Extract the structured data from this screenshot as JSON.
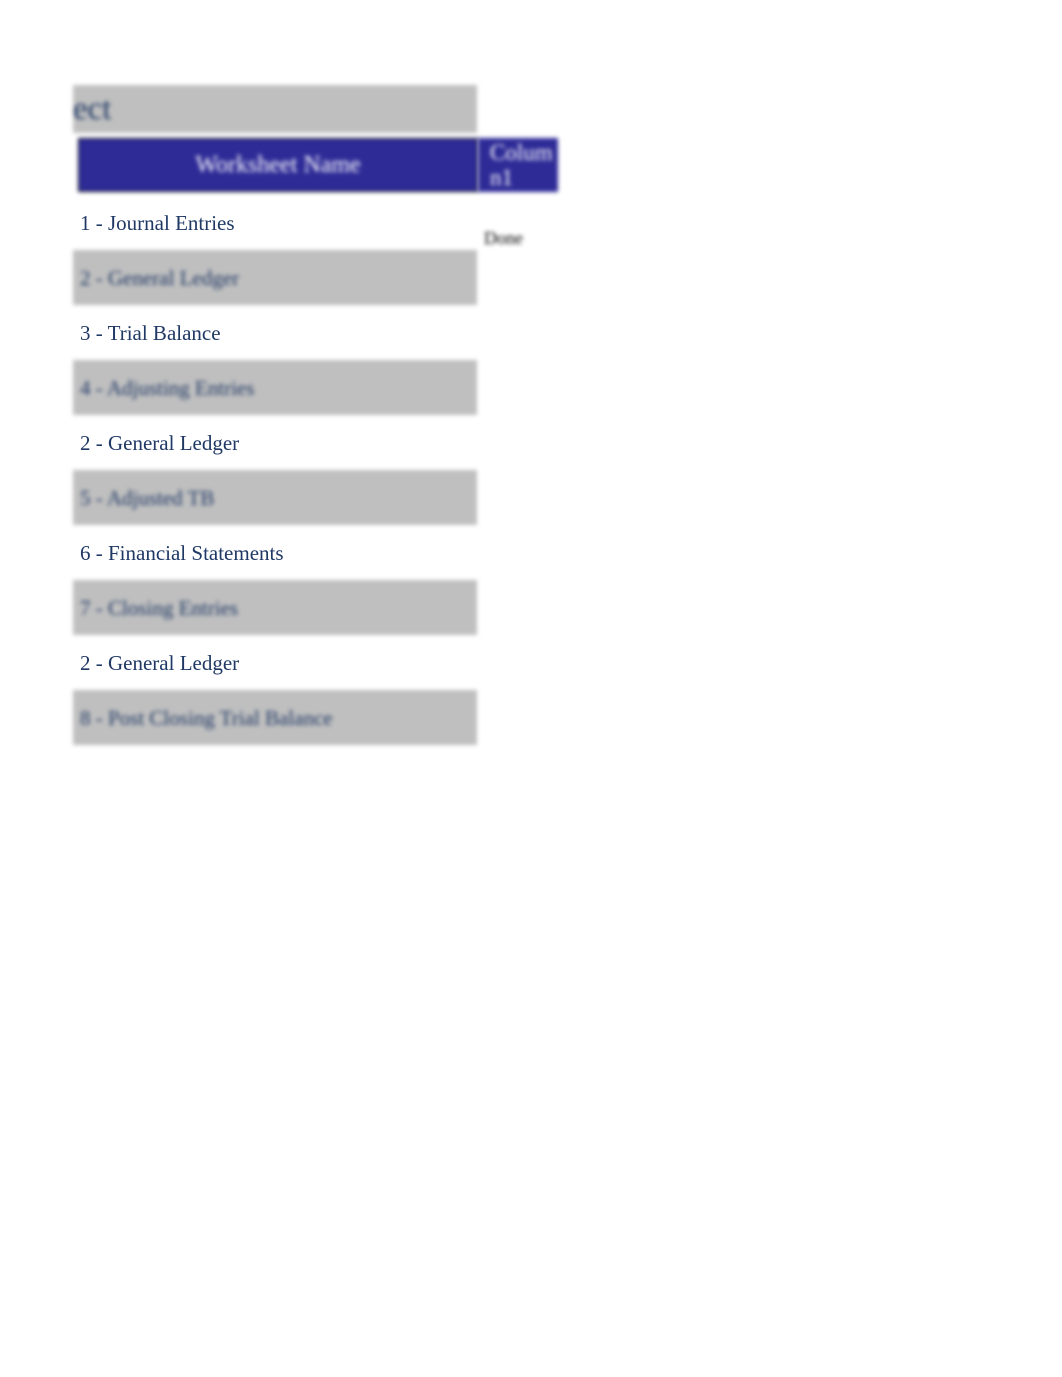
{
  "title_fragment": "ect",
  "headers": {
    "col1": "Worksheet Name",
    "col2": "Column1"
  },
  "rows": [
    {
      "name": "1 - Journal Entries",
      "status": "Done"
    },
    {
      "name": "2 - General Ledger",
      "status": ""
    },
    {
      "name": "3 - Trial Balance",
      "status": ""
    },
    {
      "name": "4 - Adjusting Entries",
      "status": ""
    },
    {
      "name": "2 - General Ledger",
      "status": ""
    },
    {
      "name": "5 - Adjusted TB",
      "status": ""
    },
    {
      "name": "6 - Financial Statements",
      "status": ""
    },
    {
      "name": "7 - Closing Entries",
      "status": ""
    },
    {
      "name": "2 - General Ledger",
      "status": ""
    },
    {
      "name": "8 - Post Closing Trial Balance",
      "status": ""
    }
  ]
}
